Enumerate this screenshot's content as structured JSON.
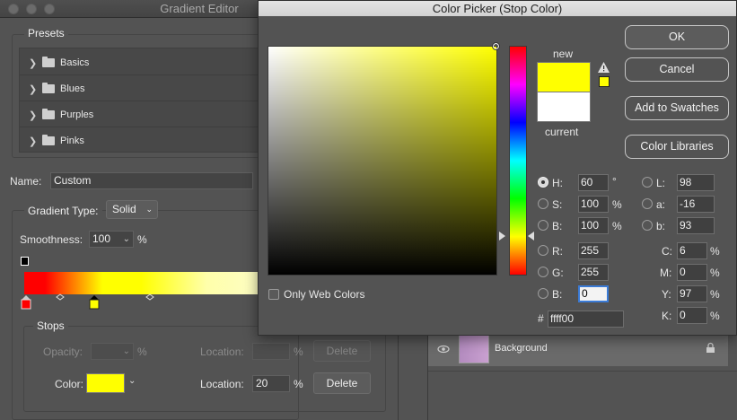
{
  "gradient_editor": {
    "title": "Gradient Editor",
    "presets_label": "Presets",
    "presets": [
      {
        "label": "Basics"
      },
      {
        "label": "Blues"
      },
      {
        "label": "Purples"
      },
      {
        "label": "Pinks"
      }
    ],
    "name_label": "Name:",
    "name_value": "Custom",
    "gradient_type_label": "Gradient Type:",
    "gradient_type_value": "Solid",
    "smoothness_label": "Smoothness:",
    "smoothness_value": "100",
    "smoothness_unit": "%",
    "stops": {
      "label": "Stops",
      "opacity_label": "Opacity:",
      "opacity_unit": "%",
      "opacity_location_label": "Location:",
      "opacity_location_unit": "%",
      "opacity_delete_label": "Delete",
      "color_label": "Color:",
      "color_swatch": "#ffff00",
      "color_location_label": "Location:",
      "color_location_value": "20",
      "color_location_unit": "%",
      "color_delete_label": "Delete"
    }
  },
  "color_picker": {
    "title": "Color Picker (Stop Color)",
    "new_label": "new",
    "current_label": "current",
    "new_color": "#ffff00",
    "current_color": "#ffffff",
    "buttons": {
      "ok": "OK",
      "cancel": "Cancel",
      "add_to_swatches": "Add to Swatches",
      "color_libraries": "Color Libraries"
    },
    "hsb": [
      {
        "key": "H:",
        "value": "60",
        "unit": "°",
        "selected": true
      },
      {
        "key": "S:",
        "value": "100",
        "unit": "%",
        "selected": false
      },
      {
        "key": "B:",
        "value": "100",
        "unit": "%",
        "selected": false
      }
    ],
    "rgb": [
      {
        "key": "R:",
        "value": "255"
      },
      {
        "key": "G:",
        "value": "255"
      },
      {
        "key": "B:",
        "value": "0"
      }
    ],
    "lab": [
      {
        "key": "L:",
        "value": "98"
      },
      {
        "key": "a:",
        "value": "-16"
      },
      {
        "key": "b:",
        "value": "93"
      }
    ],
    "cmyk": [
      {
        "key": "C:",
        "value": "6",
        "unit": "%"
      },
      {
        "key": "M:",
        "value": "0",
        "unit": "%"
      },
      {
        "key": "Y:",
        "value": "97",
        "unit": "%"
      },
      {
        "key": "K:",
        "value": "0",
        "unit": "%"
      }
    ],
    "hex_label": "#",
    "hex_value": "ffff00",
    "only_web_colors_label": "Only Web Colors",
    "warning_swatch": "#ffff00"
  },
  "layers": {
    "layer_name": "Background"
  }
}
